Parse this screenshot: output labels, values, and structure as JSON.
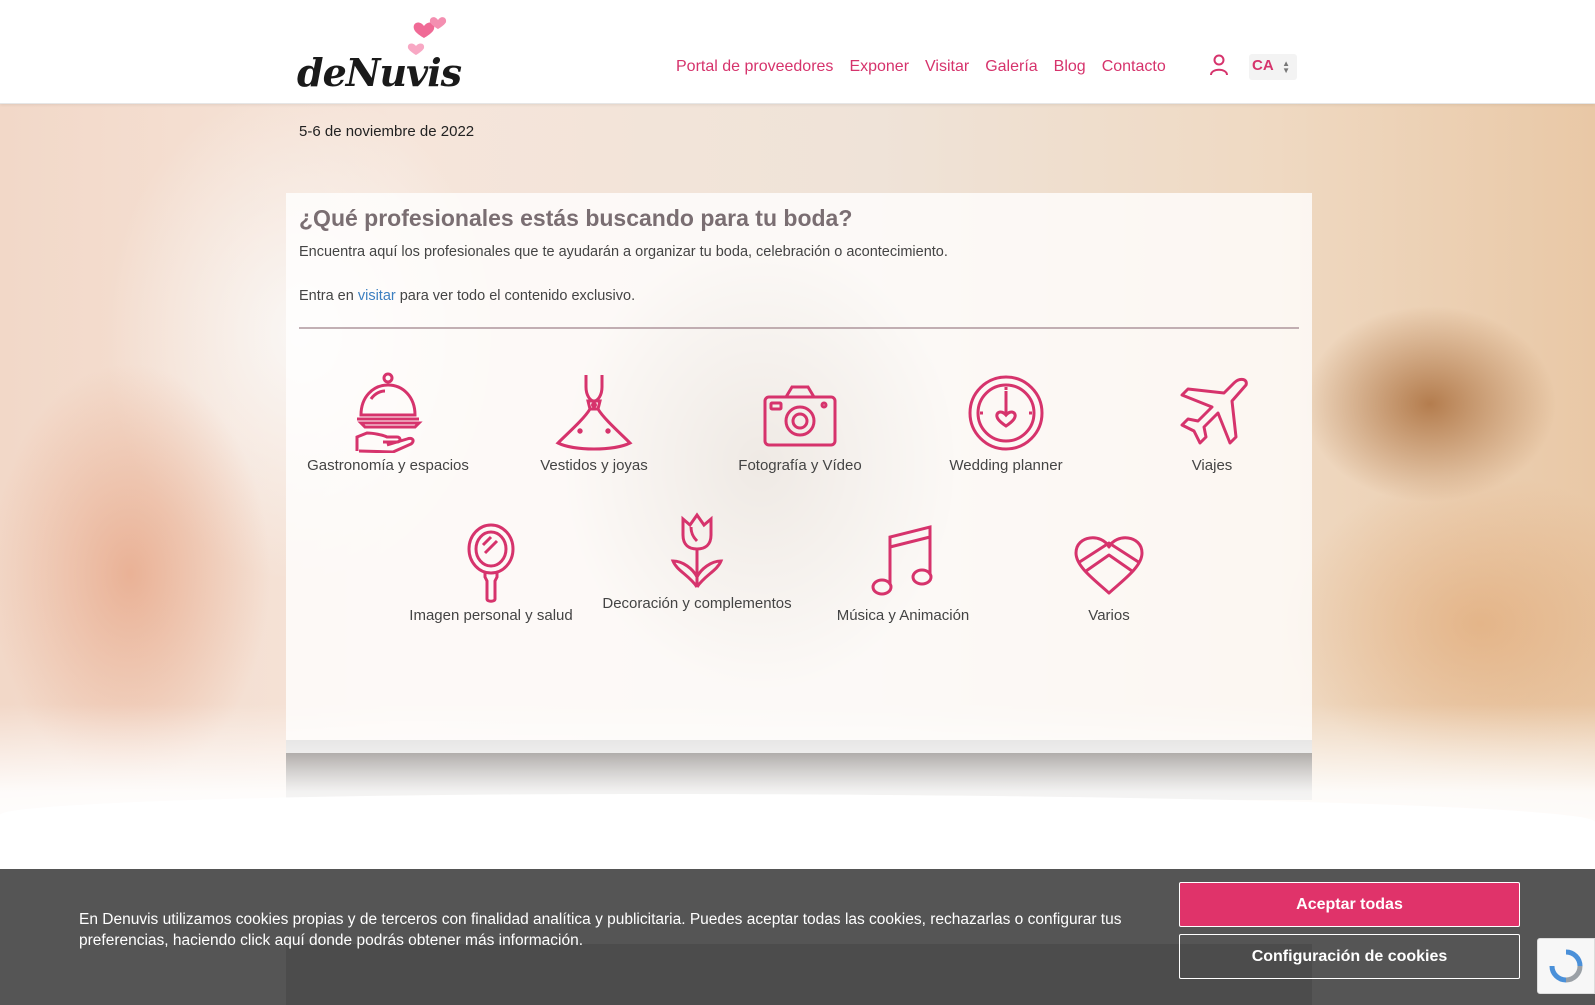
{
  "header": {
    "brand": "deNuvis",
    "nav": [
      "Portal de proveedores",
      "Exponer",
      "Visitar",
      "Galería",
      "Blog",
      "Contacto"
    ],
    "lang": "CA"
  },
  "hero": {
    "date": "5-6 de noviembre de 2022"
  },
  "panel": {
    "title": "¿Qué profesionales estás buscando para tu boda?",
    "description": "Encuentra aquí los profesionales que te ayudarán a organizar tu boda, celebración o acontecimiento.",
    "entry_prefix": "Entra en ",
    "entry_link": "visitar",
    "entry_suffix": " para ver todo el contenido exclusivo.",
    "categories": [
      {
        "label": "Gastronomía y espacios",
        "icon": "cloche-icon"
      },
      {
        "label": "Vestidos y joyas",
        "icon": "dress-icon"
      },
      {
        "label": "Fotografía y Vídeo",
        "icon": "camera-icon"
      },
      {
        "label": "Wedding planner",
        "icon": "clock-heart-icon"
      },
      {
        "label": "Viajes",
        "icon": "airplane-icon"
      },
      {
        "label": "Imagen personal y salud",
        "icon": "mirror-icon"
      },
      {
        "label": "Decoración y complementos",
        "icon": "tulip-icon"
      },
      {
        "label": "Música y Animación",
        "icon": "music-note-icon"
      },
      {
        "label": "Varios",
        "icon": "heart-envelope-icon"
      }
    ]
  },
  "cookie": {
    "text": "En Denuvis utilizamos cookies propias y de terceros con finalidad analítica y publicitaria. Puedes aceptar todas las cookies, rechazarlas o configurar tus preferencias, haciendo click aquí donde podrás obtener más información.",
    "accept_label": "Aceptar todas",
    "config_label": "Configuración de cookies"
  },
  "colors": {
    "accent": "#d6336c",
    "accept_button": "#e0336a",
    "cookie_bar": "#4e4e4e"
  }
}
